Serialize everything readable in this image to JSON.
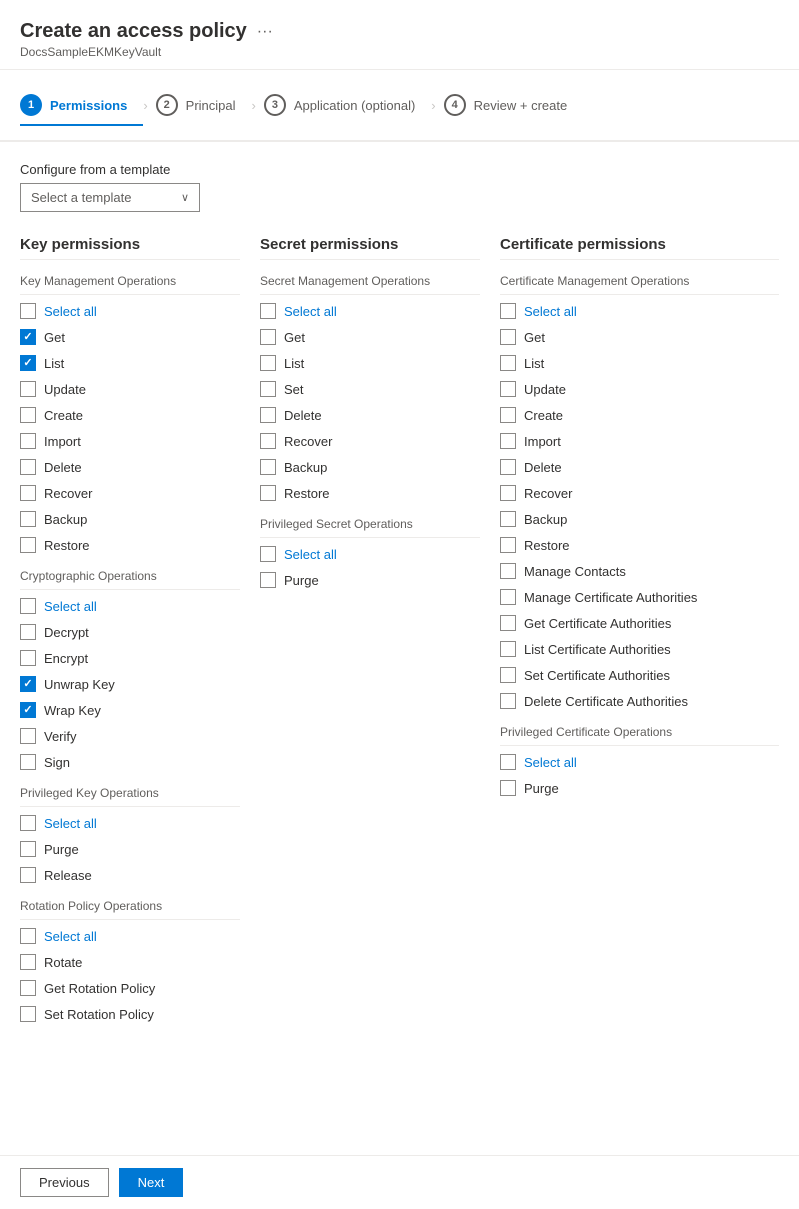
{
  "header": {
    "title": "Create an access policy",
    "subtitle": "DocsSampleEKMKeyVault",
    "more_label": "···"
  },
  "wizard": {
    "steps": [
      {
        "num": "1",
        "label": "Permissions",
        "state": "active"
      },
      {
        "num": "2",
        "label": "Principal",
        "state": "inactive"
      },
      {
        "num": "3",
        "label": "Application (optional)",
        "state": "inactive"
      },
      {
        "num": "4",
        "label": "Review + create",
        "state": "inactive"
      }
    ]
  },
  "template": {
    "label": "Configure from a template",
    "placeholder": "Select a template"
  },
  "key_permissions": {
    "title": "Key permissions",
    "groups": [
      {
        "name": "Key Management Operations",
        "items": [
          {
            "label": "Select all",
            "checked": false,
            "link": true
          },
          {
            "label": "Get",
            "checked": true
          },
          {
            "label": "List",
            "checked": true
          },
          {
            "label": "Update",
            "checked": false
          },
          {
            "label": "Create",
            "checked": false
          },
          {
            "label": "Import",
            "checked": false
          },
          {
            "label": "Delete",
            "checked": false
          },
          {
            "label": "Recover",
            "checked": false
          },
          {
            "label": "Backup",
            "checked": false
          },
          {
            "label": "Restore",
            "checked": false
          }
        ]
      },
      {
        "name": "Cryptographic Operations",
        "items": [
          {
            "label": "Select all",
            "checked": false,
            "link": true
          },
          {
            "label": "Decrypt",
            "checked": false
          },
          {
            "label": "Encrypt",
            "checked": false
          },
          {
            "label": "Unwrap Key",
            "checked": true
          },
          {
            "label": "Wrap Key",
            "checked": true
          },
          {
            "label": "Verify",
            "checked": false
          },
          {
            "label": "Sign",
            "checked": false
          }
        ]
      },
      {
        "name": "Privileged Key Operations",
        "items": [
          {
            "label": "Select all",
            "checked": false,
            "link": true
          },
          {
            "label": "Purge",
            "checked": false
          },
          {
            "label": "Release",
            "checked": false
          }
        ]
      },
      {
        "name": "Rotation Policy Operations",
        "items": [
          {
            "label": "Select all",
            "checked": false,
            "link": true
          },
          {
            "label": "Rotate",
            "checked": false
          },
          {
            "label": "Get Rotation Policy",
            "checked": false
          },
          {
            "label": "Set Rotation Policy",
            "checked": false
          }
        ]
      }
    ]
  },
  "secret_permissions": {
    "title": "Secret permissions",
    "groups": [
      {
        "name": "Secret Management Operations",
        "items": [
          {
            "label": "Select all",
            "checked": false,
            "link": true
          },
          {
            "label": "Get",
            "checked": false
          },
          {
            "label": "List",
            "checked": false
          },
          {
            "label": "Set",
            "checked": false
          },
          {
            "label": "Delete",
            "checked": false
          },
          {
            "label": "Recover",
            "checked": false
          },
          {
            "label": "Backup",
            "checked": false
          },
          {
            "label": "Restore",
            "checked": false
          }
        ]
      },
      {
        "name": "Privileged Secret Operations",
        "items": [
          {
            "label": "Select all",
            "checked": false,
            "link": true
          },
          {
            "label": "Purge",
            "checked": false
          }
        ]
      }
    ]
  },
  "certificate_permissions": {
    "title": "Certificate permissions",
    "groups": [
      {
        "name": "Certificate Management Operations",
        "items": [
          {
            "label": "Select all",
            "checked": false,
            "link": true
          },
          {
            "label": "Get",
            "checked": false
          },
          {
            "label": "List",
            "checked": false
          },
          {
            "label": "Update",
            "checked": false
          },
          {
            "label": "Create",
            "checked": false
          },
          {
            "label": "Import",
            "checked": false
          },
          {
            "label": "Delete",
            "checked": false
          },
          {
            "label": "Recover",
            "checked": false
          },
          {
            "label": "Backup",
            "checked": false
          },
          {
            "label": "Restore",
            "checked": false
          },
          {
            "label": "Manage Contacts",
            "checked": false
          },
          {
            "label": "Manage Certificate Authorities",
            "checked": false
          },
          {
            "label": "Get Certificate Authorities",
            "checked": false
          },
          {
            "label": "List Certificate Authorities",
            "checked": false
          },
          {
            "label": "Set Certificate Authorities",
            "checked": false
          },
          {
            "label": "Delete Certificate Authorities",
            "checked": false
          }
        ]
      },
      {
        "name": "Privileged Certificate Operations",
        "items": [
          {
            "label": "Select all",
            "checked": false,
            "link": true
          },
          {
            "label": "Purge",
            "checked": false
          }
        ]
      }
    ]
  },
  "footer": {
    "previous_label": "Previous",
    "next_label": "Next"
  }
}
